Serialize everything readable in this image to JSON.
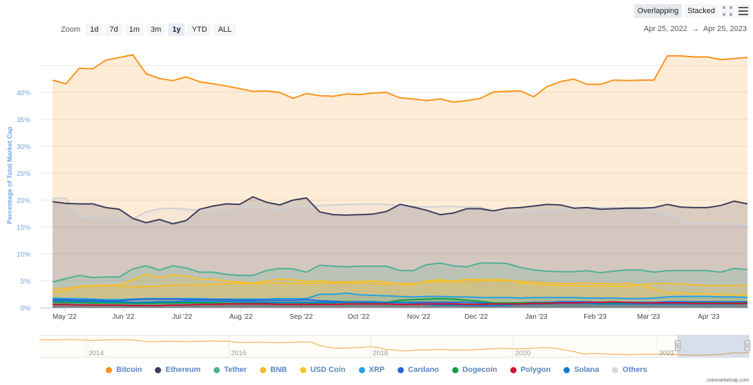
{
  "toolbar": {
    "overlapping_label": "Overlapping",
    "stacked_label": "Stacked",
    "fullscreen_icon": "fullscreen-icon",
    "menu_icon": "hamburger-menu-icon"
  },
  "zoom": {
    "label": "Zoom",
    "options": [
      "1d",
      "7d",
      "1m",
      "3m",
      "1y",
      "YTD",
      "ALL"
    ],
    "selected": "1y"
  },
  "date_range": {
    "from": "Apr 25, 2022",
    "arrow": "→",
    "to": "Apr 25, 2023"
  },
  "credit": "coinmarketcap.com",
  "chart_data": {
    "type": "area",
    "mode": "overlapping",
    "ylabel": "Percentage of Total Market Cap",
    "xlabel": "",
    "ylim": [
      0,
      45
    ],
    "yticks": [
      "0%",
      "5%",
      "10%",
      "15%",
      "20%",
      "25%",
      "30%",
      "35%",
      "40%"
    ],
    "ytick_values": [
      0,
      5,
      10,
      15,
      20,
      25,
      30,
      35,
      40,
      45
    ],
    "x_start": "Apr 25, 2022",
    "x_end": "Apr 25, 2023",
    "xticks": [
      "May '22",
      "Jun '22",
      "Jul '22",
      "Aug '22",
      "Sep '22",
      "Oct '22",
      "Nov '22",
      "Dec '22",
      "Jan '23",
      "Feb '23",
      "Mar '23",
      "Apr '23"
    ],
    "xtick_weeks": [
      0.9,
      5.3,
      9.7,
      14.1,
      18.6,
      22.9,
      27.4,
      31.7,
      36.2,
      40.6,
      44.6,
      49.1
    ],
    "grid": true,
    "legend": "bottom",
    "series": [
      {
        "name": "Bitcoin",
        "color": "#f7931a",
        "values": [
          42.3,
          41.6,
          44.5,
          44.4,
          46.0,
          46.5,
          47.0,
          43.5,
          42.6,
          42.2,
          42.9,
          42.0,
          41.6,
          41.2,
          40.7,
          40.2,
          40.3,
          40.0,
          38.9,
          39.8,
          39.4,
          39.3,
          39.7,
          39.6,
          39.9,
          40.0,
          39.0,
          38.8,
          38.5,
          38.8,
          38.2,
          38.5,
          38.9,
          40.1,
          40.2,
          40.3,
          39.2,
          41.1,
          42.0,
          42.5,
          41.5,
          41.5,
          42.3,
          42.2,
          42.3,
          42.3,
          46.8,
          46.8,
          46.6,
          46.6,
          46.1,
          46.3,
          46.5
        ]
      },
      {
        "name": "Others",
        "color": "#cfcfd4",
        "values": [
          20.3,
          20.4,
          16.7,
          17.0,
          16.5,
          16.5,
          16.5,
          17.8,
          18.4,
          18.5,
          18.3,
          18.1,
          17.8,
          18.2,
          18.7,
          18.7,
          18.5,
          18.4,
          18.7,
          18.8,
          19.0,
          19.1,
          19.2,
          19.2,
          19.3,
          19.2,
          18.9,
          18.8,
          18.7,
          18.8,
          18.8,
          18.7,
          18.7,
          17.9,
          17.8,
          17.7,
          18.0,
          17.9,
          18.0,
          18.4,
          18.6,
          18.6,
          18.6,
          18.6,
          18.6,
          17.8,
          17.5,
          16.0,
          15.6,
          15.6,
          15.7,
          15.5,
          15.3
        ]
      },
      {
        "name": "Ethereum",
        "color": "#3c3c5d",
        "values": [
          19.7,
          19.4,
          19.3,
          19.3,
          18.6,
          18.3,
          16.6,
          15.8,
          16.4,
          15.6,
          16.2,
          18.3,
          18.9,
          19.3,
          19.2,
          20.6,
          19.6,
          19.1,
          20.0,
          20.4,
          17.8,
          17.3,
          17.2,
          17.3,
          17.4,
          17.9,
          19.2,
          18.7,
          18.1,
          17.3,
          17.6,
          18.4,
          18.4,
          18.0,
          18.5,
          18.6,
          18.9,
          19.2,
          19.1,
          18.5,
          18.6,
          18.3,
          18.4,
          18.5,
          18.5,
          18.6,
          19.2,
          18.7,
          18.6,
          18.6,
          19.0,
          19.8,
          19.3
        ]
      },
      {
        "name": "Tether",
        "color": "#50af95",
        "values": [
          4.8,
          5.4,
          6.0,
          5.6,
          5.7,
          5.7,
          7.2,
          7.8,
          7.0,
          7.8,
          7.4,
          6.6,
          6.6,
          6.2,
          6.0,
          6.0,
          6.9,
          7.3,
          7.2,
          6.6,
          7.9,
          7.7,
          7.6,
          7.7,
          7.7,
          7.7,
          6.9,
          6.9,
          8.0,
          8.3,
          7.8,
          7.6,
          8.3,
          8.3,
          8.2,
          7.5,
          7.0,
          6.8,
          6.7,
          6.7,
          6.9,
          6.5,
          6.8,
          7.0,
          7.0,
          6.6,
          6.9,
          6.9,
          6.9,
          6.9,
          6.6,
          7.3,
          7.1
        ]
      },
      {
        "name": "USD Coin",
        "color": "#f6c32d",
        "values": [
          2.9,
          3.2,
          4.0,
          4.1,
          4.2,
          4.2,
          5.2,
          6.2,
          5.6,
          6.1,
          5.9,
          5.3,
          5.3,
          5.0,
          4.8,
          4.6,
          5.0,
          5.3,
          5.2,
          4.9,
          5.0,
          4.8,
          4.8,
          4.9,
          5.0,
          4.7,
          4.4,
          4.3,
          5.0,
          5.2,
          4.9,
          5.3,
          5.2,
          5.2,
          5.2,
          4.6,
          4.4,
          4.2,
          4.1,
          4.1,
          4.0,
          4.1,
          4.0,
          3.9,
          4.3,
          3.5,
          2.8,
          2.8,
          2.6,
          2.6,
          2.5,
          2.3,
          2.4
        ]
      },
      {
        "name": "BNB",
        "color": "#f3ba2f",
        "values": [
          3.6,
          3.6,
          3.9,
          4.0,
          4.1,
          4.1,
          3.8,
          3.9,
          4.0,
          4.2,
          4.2,
          4.3,
          4.3,
          4.5,
          4.5,
          4.5,
          4.5,
          4.6,
          4.6,
          4.5,
          4.6,
          4.6,
          4.6,
          4.6,
          4.5,
          4.4,
          4.5,
          4.5,
          4.8,
          4.9,
          4.8,
          4.8,
          5.0,
          5.1,
          5.0,
          4.9,
          4.8,
          4.6,
          4.5,
          4.5,
          4.6,
          4.5,
          4.4,
          4.5,
          4.2,
          4.5,
          4.5,
          4.4,
          4.3,
          4.1,
          4.1,
          4.1,
          4.2
        ]
      },
      {
        "name": "XRP",
        "color": "#23a1e0",
        "values": [
          1.8,
          1.7,
          1.7,
          1.6,
          1.5,
          1.5,
          1.6,
          1.7,
          1.7,
          1.7,
          1.7,
          1.7,
          1.6,
          1.6,
          1.6,
          1.6,
          1.6,
          1.7,
          1.7,
          1.7,
          2.5,
          2.5,
          2.7,
          2.4,
          2.3,
          2.2,
          2.1,
          2.0,
          2.1,
          2.1,
          2.0,
          2.0,
          1.9,
          1.9,
          1.9,
          1.8,
          1.9,
          1.9,
          1.9,
          1.9,
          1.8,
          1.8,
          1.8,
          1.7,
          1.7,
          1.8,
          2.0,
          2.1,
          2.1,
          2.1,
          2.0,
          2.0,
          1.9
        ]
      },
      {
        "name": "Cardano",
        "color": "#2565d8",
        "values": [
          1.5,
          1.5,
          1.4,
          1.4,
          1.3,
          1.3,
          1.5,
          1.6,
          1.6,
          1.6,
          1.5,
          1.5,
          1.5,
          1.5,
          1.4,
          1.4,
          1.4,
          1.4,
          1.4,
          1.5,
          1.3,
          1.2,
          1.1,
          1.1,
          1.1,
          1.0,
          1.0,
          1.0,
          1.0,
          1.0,
          1.0,
          1.0,
          0.9,
          0.9,
          0.9,
          0.9,
          1.0,
          1.0,
          1.1,
          1.1,
          1.1,
          1.0,
          1.0,
          1.0,
          1.0,
          1.0,
          1.1,
          1.1,
          1.1,
          1.1,
          1.1,
          1.1,
          1.1
        ]
      },
      {
        "name": "Dogecoin",
        "color": "#0f9d40",
        "values": [
          1.1,
          1.0,
          1.0,
          0.9,
          0.9,
          0.9,
          0.8,
          0.8,
          0.9,
          0.9,
          0.9,
          0.9,
          0.9,
          0.8,
          0.8,
          0.8,
          0.8,
          0.7,
          0.7,
          0.7,
          0.9,
          0.9,
          1.1,
          1.0,
          1.0,
          1.0,
          1.4,
          1.5,
          1.6,
          1.7,
          1.6,
          1.4,
          1.2,
          0.9,
          0.9,
          0.9,
          0.9,
          0.9,
          0.9,
          0.9,
          0.9,
          0.9,
          0.8,
          0.8,
          0.8,
          0.8,
          0.8,
          0.9,
          0.9,
          0.9,
          0.9,
          0.9,
          0.9
        ]
      },
      {
        "name": "Solana",
        "color": "#0c7dd0",
        "values": [
          1.3,
          1.3,
          1.2,
          1.2,
          1.1,
          1.1,
          1.0,
          1.0,
          1.1,
          1.1,
          1.2,
          1.2,
          1.2,
          1.2,
          1.1,
          1.1,
          1.0,
          1.0,
          1.0,
          1.0,
          1.0,
          1.0,
          1.0,
          1.0,
          1.0,
          1.0,
          1.0,
          0.9,
          0.6,
          0.5,
          0.5,
          0.5,
          0.4,
          0.4,
          0.5,
          0.6,
          0.7,
          0.7,
          0.8,
          0.8,
          0.8,
          0.7,
          0.7,
          0.7,
          0.7,
          0.7,
          0.7,
          0.7,
          0.7,
          0.7,
          0.7,
          0.7,
          0.8
        ]
      },
      {
        "name": "Polygon",
        "color": "#d0102f",
        "values": [
          0.6,
          0.6,
          0.5,
          0.5,
          0.5,
          0.5,
          0.4,
          0.4,
          0.4,
          0.5,
          0.5,
          0.6,
          0.6,
          0.7,
          0.7,
          0.7,
          0.7,
          0.6,
          0.6,
          0.6,
          0.6,
          0.6,
          0.7,
          0.7,
          0.7,
          0.7,
          0.6,
          0.6,
          0.7,
          0.7,
          0.7,
          0.6,
          0.6,
          0.7,
          0.7,
          0.7,
          0.8,
          0.8,
          0.9,
          0.9,
          1.0,
          1.0,
          1.1,
          1.0,
          0.9,
          0.9,
          0.9,
          0.9,
          0.8,
          0.8,
          0.8,
          0.8,
          0.8
        ]
      }
    ],
    "navigator": {
      "xticks": [
        "2014",
        "2016",
        "2018",
        "2020",
        "2022"
      ],
      "series_name": "Bitcoin",
      "values": [
        94,
        94,
        93,
        94,
        95,
        93,
        92,
        92,
        93,
        94,
        94,
        93,
        91,
        87,
        87,
        88,
        88,
        88,
        87,
        88,
        89,
        90,
        89,
        88,
        84,
        84,
        85,
        85,
        84,
        83,
        84,
        85,
        86,
        85,
        73,
        67,
        63,
        64,
        65,
        66,
        69,
        66,
        59,
        57,
        53,
        55,
        57,
        57,
        58,
        58,
        57,
        57,
        56,
        58,
        60,
        62,
        63,
        62,
        61,
        62,
        63,
        66,
        64,
        61,
        55,
        50,
        42,
        44,
        43,
        42,
        42,
        40,
        41,
        42,
        42,
        42,
        43,
        41,
        39,
        38,
        38,
        39,
        40,
        42,
        46,
        46,
        47
      ],
      "range_selected": [
        "Apr 2022",
        "Apr 2023"
      ]
    }
  },
  "legend": [
    {
      "name": "Bitcoin",
      "color": "#f7931a"
    },
    {
      "name": "Ethereum",
      "color": "#3c3c5d"
    },
    {
      "name": "Tether",
      "color": "#50af95"
    },
    {
      "name": "BNB",
      "color": "#f3ba2f"
    },
    {
      "name": "USD Coin",
      "color": "#f6c32d"
    },
    {
      "name": "XRP",
      "color": "#23a1e0"
    },
    {
      "name": "Cardano",
      "color": "#2565d8"
    },
    {
      "name": "Dogecoin",
      "color": "#0f9d40"
    },
    {
      "name": "Polygon",
      "color": "#d0102f"
    },
    {
      "name": "Solana",
      "color": "#0c7dd0"
    },
    {
      "name": "Others",
      "color": "#d9d9d9"
    }
  ]
}
